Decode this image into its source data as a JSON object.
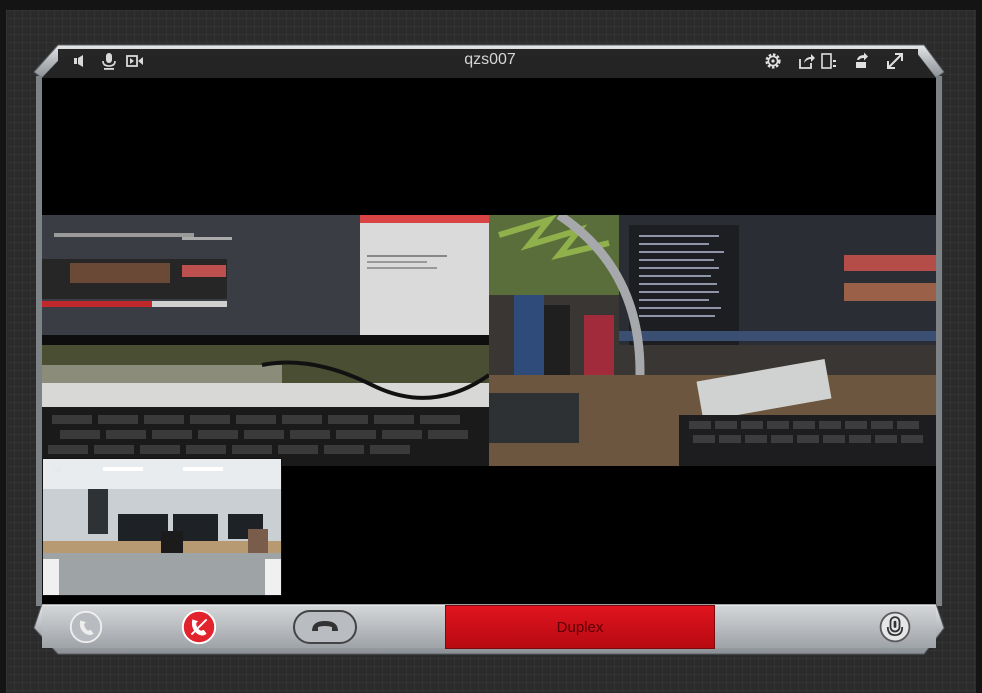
{
  "window": {
    "title": "qzs007"
  },
  "topbar": {
    "left_icons": [
      "speaker-icon",
      "microphone-icon",
      "camera-icon"
    ],
    "right_icons": [
      "settings-gear-icon",
      "share-screen-icon",
      "layout-split-icon",
      "rotate-icon",
      "fullscreen-icon"
    ]
  },
  "videos": {
    "left": {
      "name": "remote-feed-1"
    },
    "right": {
      "name": "remote-feed-2"
    },
    "pip": {
      "name": "local-preview",
      "toggle_icon": "minimize-arrow-icon"
    }
  },
  "controls": {
    "answer_icon": "answer-call-icon",
    "hangup_icon": "hang-up-icon",
    "hold_icon": "handset-hold-icon",
    "duplex_label": "Duplex",
    "mic_icon": "push-to-talk-mic-icon"
  },
  "colors": {
    "accent_red": "#d0101a",
    "frame_gray": "#bfc2c5",
    "topbar_dark": "#2a2a2a"
  }
}
